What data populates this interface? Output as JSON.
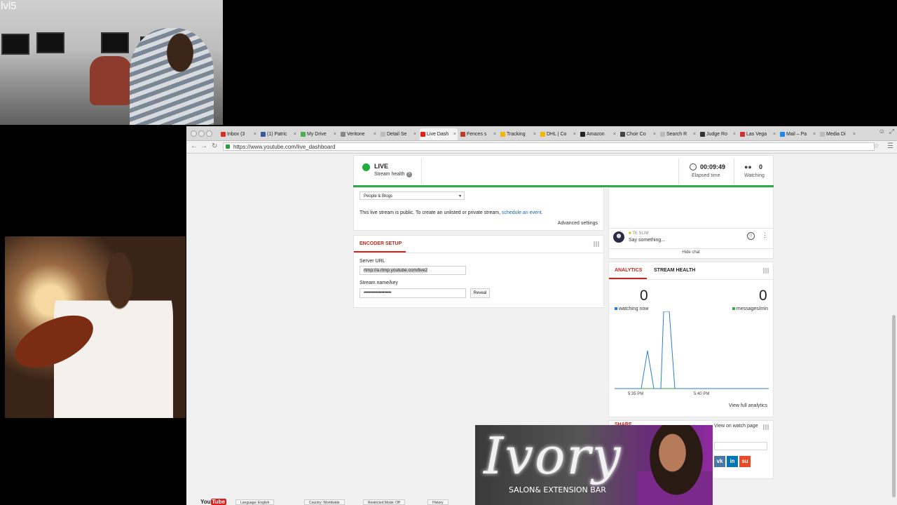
{
  "overlay": {
    "cam_label": "lvl5"
  },
  "browser": {
    "tabs": [
      {
        "label": "Inbox (3",
        "color": "#d93025"
      },
      {
        "label": "(1) Patric",
        "color": "#3b5998"
      },
      {
        "label": "My Drive",
        "color": "#4caf50"
      },
      {
        "label": "Veritone",
        "color": "#888888"
      },
      {
        "label": "Detail Se",
        "color": "#bbbbbb"
      },
      {
        "label": "Live Dash",
        "color": "#e62117"
      },
      {
        "label": "Fences s",
        "color": "#c0392b"
      },
      {
        "label": "Tracking",
        "color": "#f2b705"
      },
      {
        "label": "DHL | Co",
        "color": "#f2b705"
      },
      {
        "label": "Amazon",
        "color": "#222222"
      },
      {
        "label": "Choir Co",
        "color": "#444444"
      },
      {
        "label": "Search R",
        "color": "#bbbbbb"
      },
      {
        "label": "Judge Ro",
        "color": "#333333"
      },
      {
        "label": "Las Vega",
        "color": "#d32f2f"
      },
      {
        "label": "Mail – Pa",
        "color": "#1e88e5"
      },
      {
        "label": "Media Di",
        "color": "#bbbbbb"
      }
    ],
    "active_tab_index": 5,
    "tab_close": "×",
    "url": "https://www.youtube.com/live_dashboard"
  },
  "status": {
    "live_label": "LIVE",
    "health_label": "Stream health",
    "elapsed_value": "00:09:49",
    "elapsed_label": "Elapsed time",
    "watching_value": "0",
    "watching_label": "Watching"
  },
  "info": {
    "category": "People & Blogs",
    "public_note": "This live stream is public. To create an unlisted or private stream,",
    "schedule_link": "schedule an event.",
    "advanced_link": "Advanced settings"
  },
  "encoder": {
    "title": "ENCODER SETUP",
    "server_label": "Server URL",
    "server_value": "rtmp://a.rtmp.youtube.com/live2",
    "key_label": "Stream name/key",
    "key_value": "••••••••••••••••••••",
    "reveal_label": "Reveal"
  },
  "chat": {
    "user": "TK SLIM",
    "placeholder": "Say something...",
    "hide_chat": "Hide chat"
  },
  "analytics": {
    "tab_analytics": "ANALYTICS",
    "tab_health": "STREAM HEALTH",
    "watching_count": "0",
    "watching_legend": "watching now",
    "messages_count": "0",
    "messages_legend": "messages/min",
    "tick_1": "5:35 PM",
    "tick_2": "5:40 PM",
    "full_analytics": "View full analytics",
    "colors": {
      "watching": "#2a7fd4",
      "messages": "#3aa83a"
    }
  },
  "share": {
    "title": "SHARE",
    "watch_page": "View on watch page",
    "socials": [
      {
        "label": "vk",
        "color": "#4a76a8"
      },
      {
        "label": "in",
        "color": "#0077b5"
      },
      {
        "label": "su",
        "color": "#eb4924"
      }
    ]
  },
  "footer": {
    "logo_a": "You",
    "logo_b": "Tube",
    "language": "Language: English",
    "country": "Country: Worldwide",
    "restricted": "Restricted Mode: Off",
    "history": "History"
  },
  "ad": {
    "script": "Ivory",
    "tagline": "SALON& EXTENSION BAR"
  }
}
